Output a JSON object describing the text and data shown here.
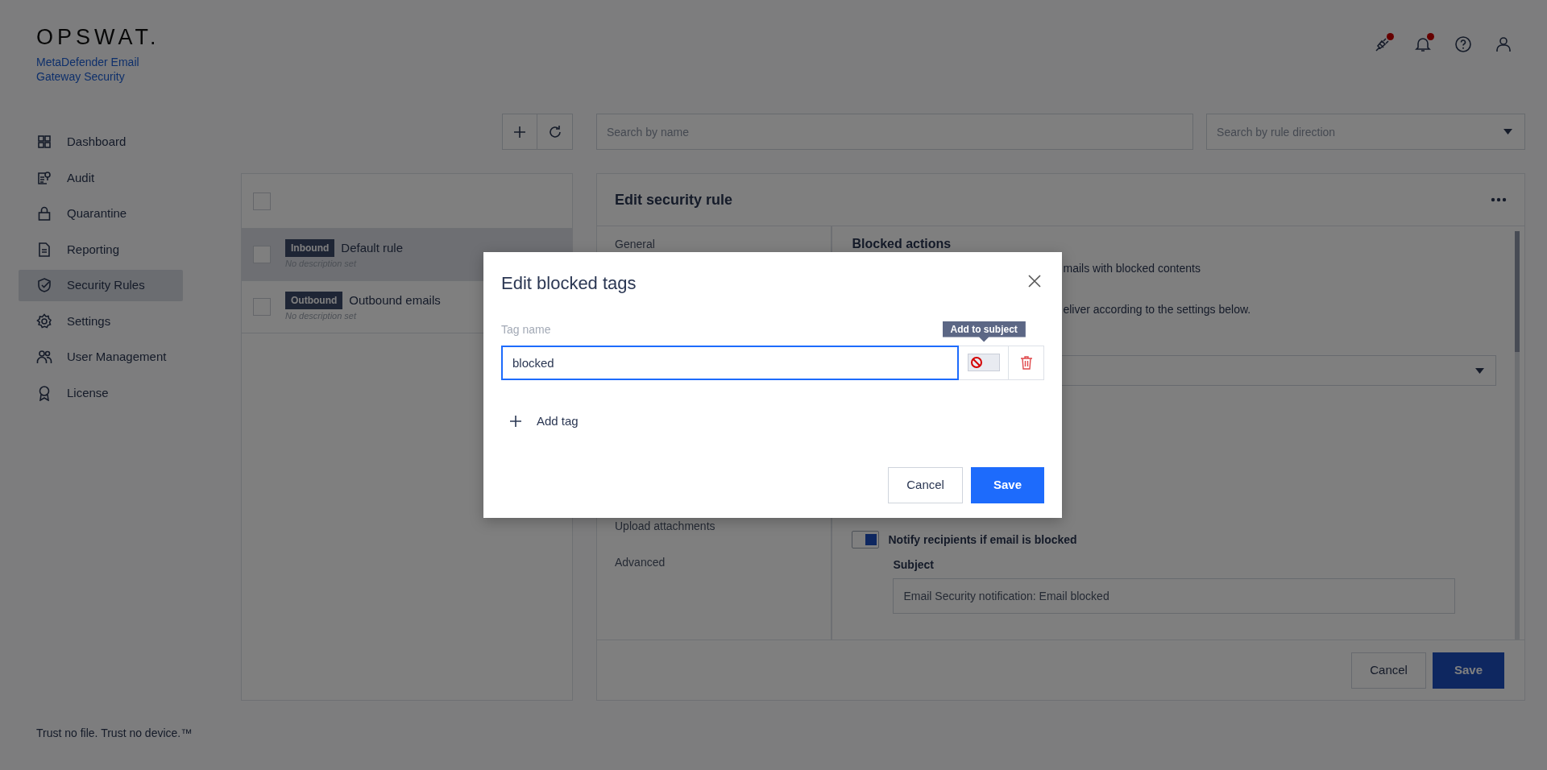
{
  "brand": {
    "logo": "OPSWAT.",
    "product": "MetaDefender Email Gateway Security"
  },
  "header_icons": [
    {
      "kind": "integration",
      "unread": true
    },
    {
      "kind": "bell",
      "unread": true
    },
    {
      "kind": "help",
      "unread": false
    },
    {
      "kind": "user",
      "unread": false
    }
  ],
  "sidebar": {
    "items": [
      {
        "label": "Dashboard",
        "kind": "grid",
        "selected": false
      },
      {
        "label": "Audit",
        "kind": "audit",
        "selected": false
      },
      {
        "label": "Quarantine",
        "kind": "lock",
        "selected": false
      },
      {
        "label": "Reporting",
        "kind": "doc",
        "selected": false
      },
      {
        "label": "Security Rules",
        "kind": "shield",
        "selected": true
      },
      {
        "label": "Settings",
        "kind": "gear",
        "selected": false
      },
      {
        "label": "User Management",
        "kind": "users",
        "selected": false
      },
      {
        "label": "License",
        "kind": "award",
        "selected": false
      }
    ]
  },
  "footer_text": "Trust no file. Trust no device.™",
  "search": {
    "name_placeholder": "Search by name",
    "direction_placeholder": "Search by rule direction"
  },
  "select_all": {
    "checked": false
  },
  "rules": [
    {
      "direction": "Inbound",
      "name": "Default rule",
      "description": "No description set",
      "selected": true,
      "checked": false
    },
    {
      "direction": "Outbound",
      "name": "Outbound emails",
      "description": "No description set",
      "selected": false,
      "checked": false
    }
  ],
  "editor": {
    "title": "Edit security rule",
    "sections": [
      {
        "label": "General",
        "selected": false
      },
      {
        "label": "Upload attachments",
        "selected": false
      },
      {
        "label": "Advanced",
        "selected": false
      }
    ],
    "heading": "Blocked actions",
    "fragments": [
      "mails with blocked contents",
      "eliver according to the settings below."
    ],
    "notify": {
      "label": "Notify recipients if email is blocked",
      "on": true
    },
    "subject": {
      "label": "Subject",
      "value": "Email Security notification: Email blocked"
    },
    "cancel": "Cancel",
    "save": "Save"
  },
  "modal": {
    "title": "Edit blocked tags",
    "field_label": "Tag name",
    "tags": [
      {
        "value": "blocked",
        "add_to_subject": false
      }
    ],
    "tooltip": "Add to subject",
    "add_label": "Add tag",
    "cancel": "Cancel",
    "save": "Save"
  }
}
